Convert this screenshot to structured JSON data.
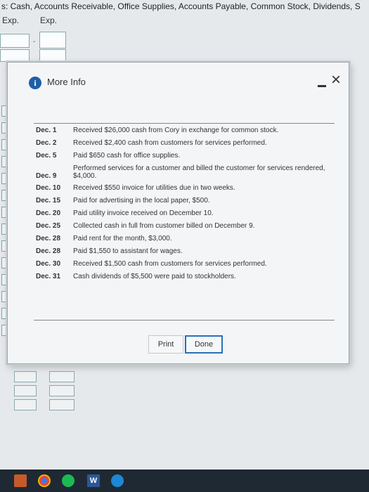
{
  "background": {
    "header_text": "s: Cash, Accounts Receivable, Office Supplies, Accounts Payable, Common Stock, Dividends, S",
    "col1_label": "Exp.",
    "col2_label": "Exp."
  },
  "dialog": {
    "title": "More Info",
    "close_symbol": "×",
    "transactions": [
      {
        "date": "Dec. 1",
        "text": "Received $26,000 cash from Cory in exchange for common stock."
      },
      {
        "date": "Dec. 2",
        "text": "Received $2,400 cash from customers for services performed."
      },
      {
        "date": "Dec. 5",
        "text": "Paid $650 cash for office supplies."
      },
      {
        "date": "Dec. 9",
        "text": "Performed services for a customer and billed the customer for services rendered, $4,000."
      },
      {
        "date": "Dec. 10",
        "text": "Received $550 invoice for utilities due in two weeks."
      },
      {
        "date": "Dec. 15",
        "text": "Paid for advertising in the local paper, $500."
      },
      {
        "date": "Dec. 20",
        "text": "Paid utility invoice received on December 10."
      },
      {
        "date": "Dec. 25",
        "text": "Collected cash in full from customer billed on December 9."
      },
      {
        "date": "Dec. 28",
        "text": "Paid rent for the month, $3,000."
      },
      {
        "date": "Dec. 28",
        "text": "Paid $1,550 to assistant for wages."
      },
      {
        "date": "Dec. 30",
        "text": "Received $1,500 cash from customers for services performed."
      },
      {
        "date": "Dec. 31",
        "text": "Cash dividends of $5,500 were paid to stockholders."
      }
    ],
    "print_label": "Print",
    "done_label": "Done"
  },
  "taskbar": {
    "icons": [
      "file-explorer-icon",
      "chrome-icon",
      "spotify-icon",
      "word-icon",
      "edge-icon"
    ],
    "word_letter": "W"
  },
  "colors": {
    "accent": "#2a6fb8",
    "info_icon": "#1f5ea8",
    "taskbar": "#1e2933"
  }
}
